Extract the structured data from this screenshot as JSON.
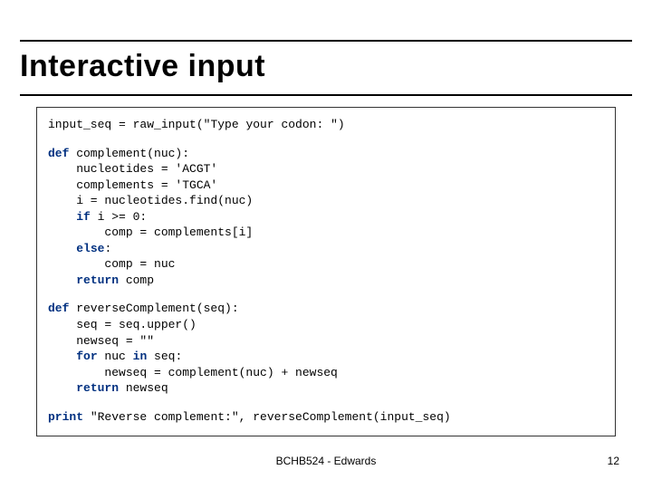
{
  "slide": {
    "title": "Interactive input",
    "footer_center": "BCHB524 - Edwards",
    "page_number": "12"
  },
  "code": {
    "line1_a": "input_seq = raw_input(",
    "line1_b": "\"Type your codon: \"",
    "line1_c": ")",
    "def1_kw": "def",
    "def1_rest": " complement(nuc):",
    "def1_l2": "    nucleotides = 'ACGT'",
    "def1_l3": "    complements = 'TGCA'",
    "def1_l4": "    i = nucleotides.find(nuc)",
    "def1_l5a": "    ",
    "def1_l5kw": "if",
    "def1_l5b": " i >= 0:",
    "def1_l6": "        comp = complements[i]",
    "def1_l7a": "    ",
    "def1_l7kw": "else",
    "def1_l7b": ":",
    "def1_l8": "        comp = nuc",
    "def1_l9a": "    ",
    "def1_l9kw": "return",
    "def1_l9b": " comp",
    "def2_kw": "def",
    "def2_rest": " reverseComplement(seq):",
    "def2_l2": "    seq = seq.upper()",
    "def2_l3": "    newseq = \"\"",
    "def2_l4a": "    ",
    "def2_l4kw": "for",
    "def2_l4b": " nuc ",
    "def2_l4kw2": "in",
    "def2_l4c": " seq:",
    "def2_l5": "        newseq = complement(nuc) + newseq",
    "def2_l6a": "    ",
    "def2_l6kw": "return",
    "def2_l6b": " newseq",
    "print_kw": "print",
    "print_rest": " \"Reverse complement:\", reverseComplement(input_seq)"
  }
}
